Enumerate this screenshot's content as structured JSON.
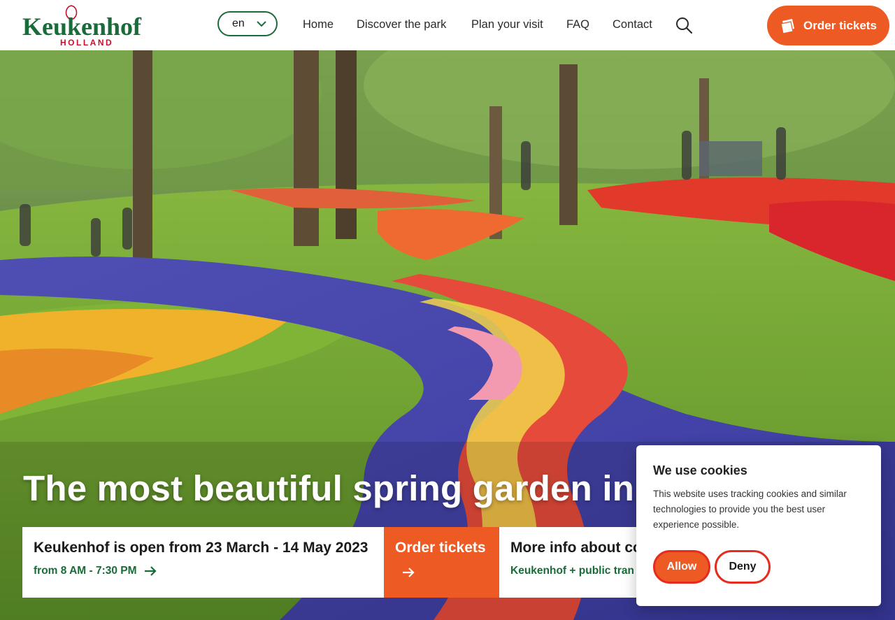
{
  "brand": {
    "name": "Keukenhof",
    "region": "HOLLAND"
  },
  "header": {
    "language": "en",
    "nav": [
      {
        "label": "Home"
      },
      {
        "label": "Discover the park"
      },
      {
        "label": "Plan your visit"
      },
      {
        "label": "FAQ"
      },
      {
        "label": "Contact"
      }
    ],
    "order_button": "Order tickets"
  },
  "hero": {
    "headline": "The most beautiful spring garden in the",
    "cards": {
      "open": {
        "title": "Keukenhof is open from 23 March - 14 May 2023",
        "subtitle": "from 8 AM - 7:30 PM"
      },
      "order": {
        "title": "Order tickets"
      },
      "more": {
        "title": "More info about co",
        "subtitle": "Keukenhof + public tran"
      }
    }
  },
  "cookie_banner": {
    "title": "We use cookies",
    "text": "This website uses tracking cookies and similar technologies to provide you the best user experience possible.",
    "allow": "Allow",
    "deny": "Deny"
  },
  "colors": {
    "accent_orange": "#ee5a24",
    "brand_green": "#1a6b3a",
    "brand_red": "#c8102e",
    "deny_border": "#e62c1e"
  },
  "icons": [
    "tulip-logo-icon",
    "chevron-down-icon",
    "search-icon",
    "ticket-icon",
    "arrow-right-icon"
  ]
}
